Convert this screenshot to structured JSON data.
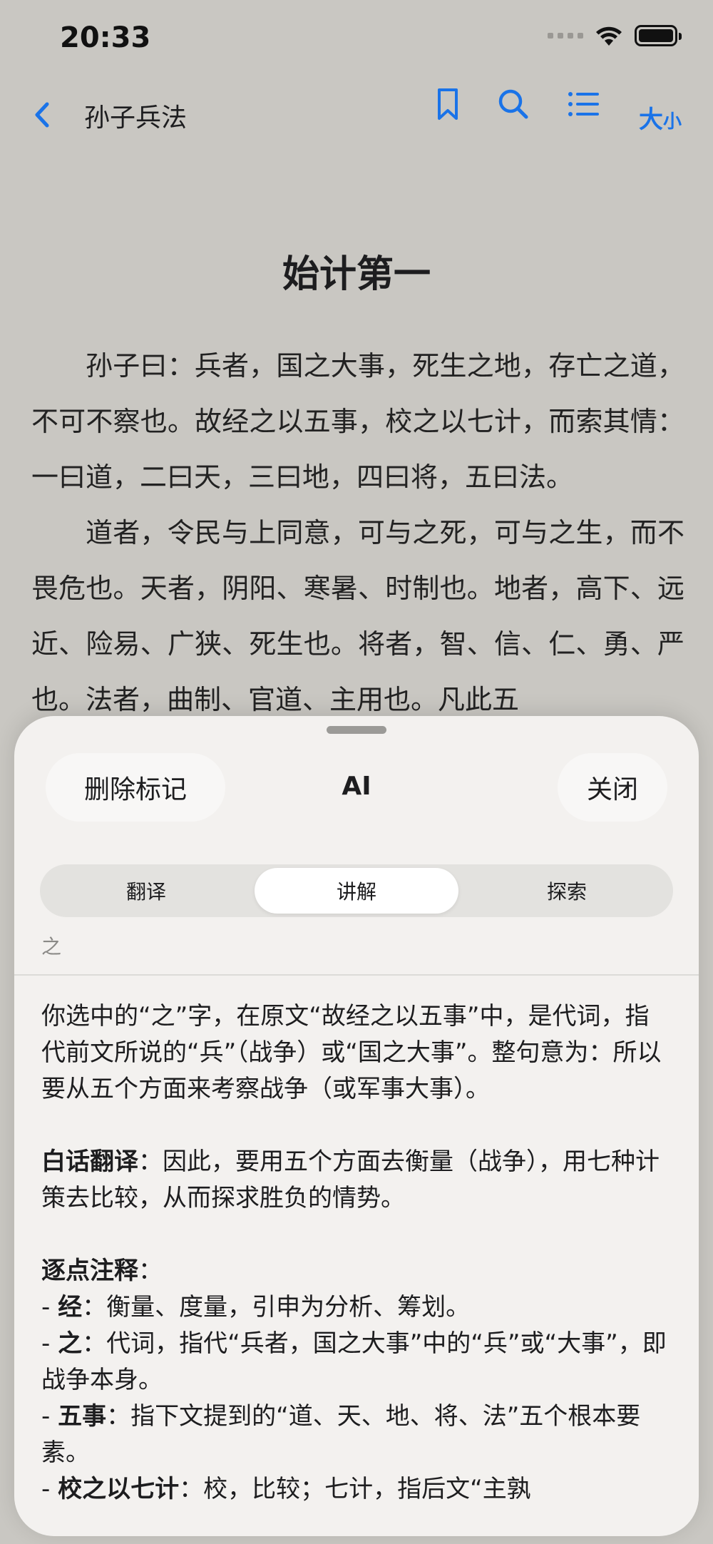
{
  "status_bar": {
    "time": "20:33"
  },
  "nav": {
    "title": "孙子兵法",
    "size_label_big": "大",
    "size_label_small": "小"
  },
  "reading": {
    "chapter_title": "始计第一",
    "paragraphs": [
      "孙子曰：兵者，国之大事，死生之地，存亡之道，不可不察也。故经之以五事，校之以七计，而索其情：一曰道，二曰天，三曰地，四曰将，五曰法。",
      "道者，令民与上同意，可与之死，可与之生，而不畏危也。天者，阴阳、寒暑、时制也。地者，高下、远近、险易、广狭、死生也。将者，智、信、仁、勇、严也。法者，曲制、官道、主用也。凡此五"
    ]
  },
  "sheet": {
    "left_button": "删除标记",
    "title": "AI",
    "right_button": "关闭",
    "tabs": [
      {
        "label": "翻译",
        "active": false
      },
      {
        "label": "讲解",
        "active": true
      },
      {
        "label": "探索",
        "active": false
      }
    ],
    "selected_text": "之",
    "intro": "你选中的“之”字，在原文“故经之以五事”中，是代词，指代前文所说的“兵”（战争）或“国之大事”。整句意为：所以要从五个方面来考察战争（或军事大事）。",
    "translation_heading": "白话翻译",
    "translation_text": "：因此，要用五个方面去衡量（战争），用七种计策去比较，从而探求胜负的情势。",
    "notes_heading": "逐点注释",
    "notes_colon": "：",
    "notes": [
      {
        "term": "经",
        "text": "：衡量、度量，引申为分析、筹划。"
      },
      {
        "term": "之",
        "text": "：代词，指代“兵者，国之大事”中的“兵”或“大事”，即战争本身。"
      },
      {
        "term": "五事",
        "text": "：指下文提到的“道、天、地、将、法”五个根本要素。"
      },
      {
        "term": "校之以七计",
        "text": "：校，比较；七计，指后文“主孰"
      }
    ]
  },
  "colors": {
    "accent": "#1a73e8",
    "background": "#c9c7c2",
    "sheet": "#f4f3f1"
  },
  "icons": [
    "chevron-left-icon",
    "bookmark-icon",
    "search-icon",
    "list-icon",
    "wifi-icon",
    "battery-icon",
    "signal-icon"
  ]
}
